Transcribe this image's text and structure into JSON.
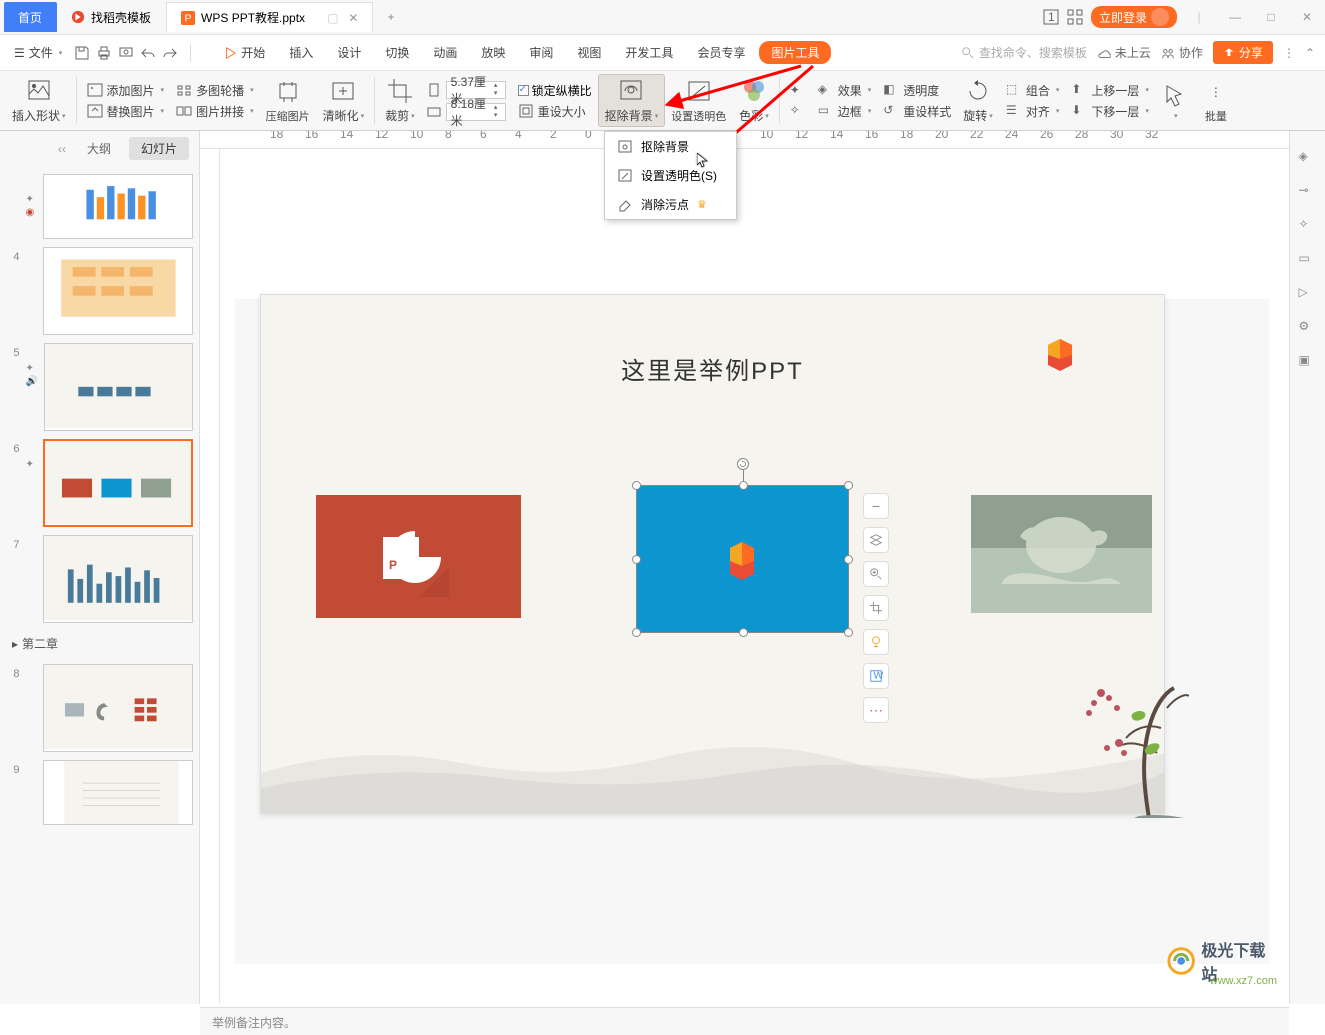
{
  "titlebar": {
    "home_tab": "首页",
    "template_tab": "找稻壳模板",
    "file_tab": "WPS PPT教程.pptx",
    "login": "立即登录",
    "add_tab": "+"
  },
  "menubar": {
    "file": "文件",
    "search_placeholder": "查找命令、搜索模板",
    "cloud": "未上云",
    "collab": "协作",
    "share": "分享",
    "items": [
      "开始",
      "插入",
      "设计",
      "切换",
      "动画",
      "放映",
      "审阅",
      "视图",
      "开发工具",
      "会员专享"
    ],
    "pictools": "图片工具"
  },
  "ribbon": {
    "insert_shape": "插入形状",
    "add_image": "添加图片",
    "replace_image": "替换图片",
    "multi_outline": "多图轮播",
    "image_stitch": "图片拼接",
    "compress_image": "压缩图片",
    "clarify": "清晰化",
    "crop": "裁剪",
    "width_label": "5.37厘米",
    "height_label": "8.18厘米",
    "lock_ratio": "锁定纵横比",
    "reset_size": "重设大小",
    "remove_bg": "抠除背景",
    "set_trans": "设置透明色",
    "color": "色彩",
    "effect": "效果",
    "border": "边框",
    "transparency": "透明度",
    "reset_style": "重设样式",
    "rotate": "旋转",
    "align": "对齐",
    "group": "组合",
    "move_up": "上移一层",
    "move_down": "下移一层",
    "batch": "批量"
  },
  "dropdown": {
    "item1": "抠除背景",
    "item2": "设置透明色(S)",
    "item3": "消除污点"
  },
  "thumbs": {
    "outline": "大纲",
    "slides": "幻灯片",
    "section2": "第二章",
    "nums": [
      "4",
      "5",
      "6",
      "7",
      "8",
      "9"
    ]
  },
  "slide": {
    "title": "这里是举例PPT"
  },
  "notes": {
    "label": "举例备注内容。"
  },
  "watermark": {
    "name": "极光下载站",
    "url": "www.xz7.com"
  },
  "chart_data": {
    "type": "other",
    "note": "screenshot of WPS Presentation UI; selected image on slide with picture tools ribbon and 抠除背景 dropdown open"
  }
}
